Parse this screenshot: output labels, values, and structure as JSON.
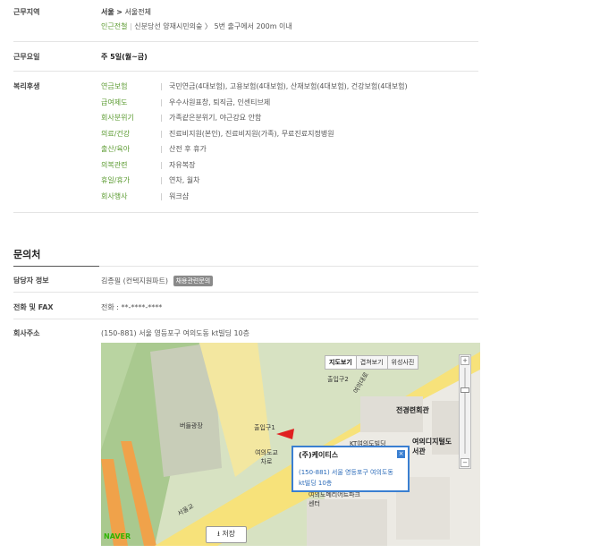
{
  "work_location": {
    "label": "근무지역",
    "region": "서울",
    "region_arrow": ">",
    "area": "서울전체",
    "nearby_label": "인근전철",
    "nearby_value": "신분당선 양재시민의숲 〉 5번 출구에서 200m 이내"
  },
  "work_days": {
    "label": "근무요일",
    "value": "주 5일(월~금)"
  },
  "welfare": {
    "label": "복리후생",
    "items": [
      {
        "key": "연금보험",
        "value": "국민연금(4대보험), 고용보험(4대보험), 산재보험(4대보험), 건강보험(4대보험)"
      },
      {
        "key": "급여제도",
        "value": "우수사원표창, 퇴직금, 인센티브제"
      },
      {
        "key": "회사분위기",
        "value": "가족같은분위기, 야근강요 안함"
      },
      {
        "key": "의료/건강",
        "value": "진료비지원(본인), 진료비지원(가족), 무료진료지정병원"
      },
      {
        "key": "출산/육아",
        "value": "산전 후 휴가"
      },
      {
        "key": "의복관련",
        "value": "자유복장"
      },
      {
        "key": "휴일/휴가",
        "value": "연차, 월차"
      },
      {
        "key": "회사행사",
        "value": "워크샵"
      }
    ],
    "separator": "|"
  },
  "contact": {
    "section_title": "문의처",
    "manager_label": "담당자 정보",
    "manager_value": "김종필 (컨텍지원파트)",
    "manager_badge": "채용관련문의",
    "phone_label": "전화 및 FAX",
    "phone_value": "전화 : **-****-****",
    "address_label": "회사주소",
    "address_value": "(150-881) 서울 영등포구 여의도동 kt빌딩 10층"
  },
  "map": {
    "view_buttons": [
      "지도보기",
      "겹쳐보기",
      "위성사진"
    ],
    "active_view": "지도보기",
    "zoom_in": "+",
    "zoom_out": "−",
    "popup_title": "(주)케이티스",
    "popup_address_1": "(150-881) 서울 영등포구 여의도동",
    "popup_address_2": "kt빌딩 10층",
    "popup_close": "×",
    "save_label": "저장",
    "brand": "NAVER",
    "labels": {
      "bldg1": "전경련회관",
      "bldg2": "여의도교차로",
      "bldg3": "버들광장",
      "bldg4": "KT여의도빌딩",
      "bldg5": "여의디지털도서관",
      "bldg6": "여의도메리어트파크센터",
      "road1": "서울교",
      "road2": "여의대로",
      "exit1": "출입구1",
      "exit2": "출입구2"
    }
  },
  "colors": {
    "accent_green": "#5a9a2f",
    "popup_blue": "#3a7fd1",
    "road_yellow": "#f7e27a",
    "river": "#9dc18a"
  }
}
